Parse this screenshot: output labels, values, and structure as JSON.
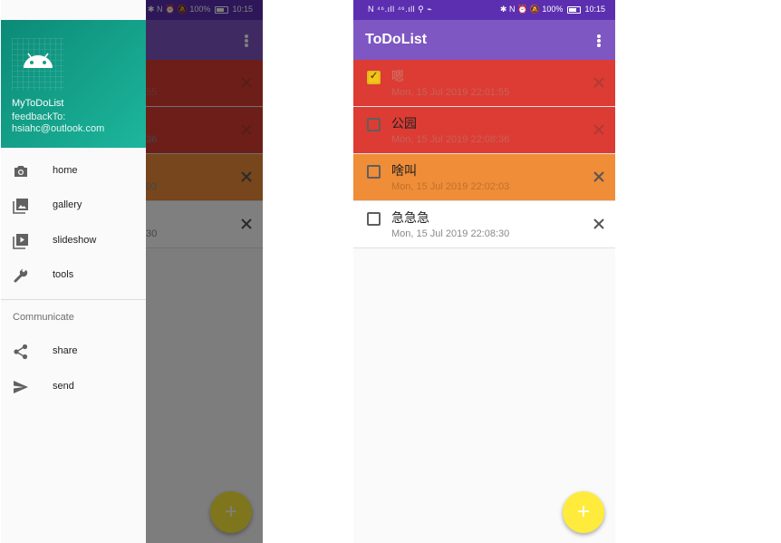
{
  "statusbar": {
    "left_icons": "N ⁴⁶.ıll ⁴⁶.ıll ⚲ ⌁",
    "right_icons": "✱ N ⏰ 🔕",
    "battery": "100%",
    "time": "10:15"
  },
  "app": {
    "title": "ToDoList"
  },
  "todos": [
    {
      "text": "嗯",
      "date": "Mon, 15 Jul 2019 22:01:55",
      "checked": true,
      "color": "#dc3c33"
    },
    {
      "text": "公园",
      "date": "Mon, 15 Jul 2019 22:08:36",
      "checked": false,
      "color": "#dc3c33"
    },
    {
      "text": "啥叫",
      "date": "Mon, 15 Jul 2019 22:02:03",
      "checked": false,
      "color": "#ef8d38"
    },
    {
      "text": "急急急",
      "date": "Mon, 15 Jul 2019 22:08:30",
      "checked": false,
      "color": "#ffffff"
    }
  ],
  "drawer": {
    "app_name": "MyToDoList",
    "feedback": "feedbackTo:",
    "email": "hsiahc@outlook.com",
    "items": [
      {
        "label": "home",
        "icon": "camera-icon"
      },
      {
        "label": "gallery",
        "icon": "gallery-icon"
      },
      {
        "label": "slideshow",
        "icon": "slideshow-icon"
      },
      {
        "label": "tools",
        "icon": "wrench-icon"
      }
    ],
    "section": "Communicate",
    "comm_items": [
      {
        "label": "share",
        "icon": "share-icon"
      },
      {
        "label": "send",
        "icon": "send-icon"
      }
    ]
  },
  "colors": {
    "accent": "#7e57c2",
    "statusbar": "#5b2fb0",
    "fab": "#ffeb3b",
    "drawer_header": "#13a08a"
  }
}
